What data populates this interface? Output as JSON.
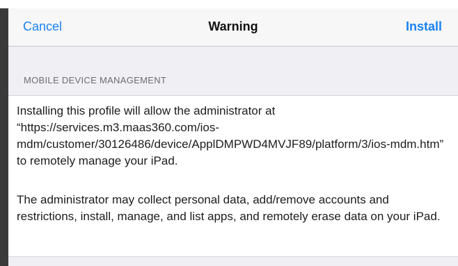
{
  "navbar": {
    "cancel_label": "Cancel",
    "title": "Warning",
    "install_label": "Install"
  },
  "section": {
    "header": "MOBILE DEVICE MANAGEMENT",
    "paragraph1": "Installing this profile will allow the administrator at “https://services.m3.maas360.com/ios-mdm/customer/30126486/device/ApplDMPWD4MVJF89/platform/3/ios-mdm.htm” to remotely manage your iPad.",
    "paragraph2": "The administrator may collect personal data, add/remove accounts and restrictions, install, manage, and list apps, and remotely erase data on your iPad."
  },
  "colors": {
    "accent": "#1a82f0",
    "nav_background": "#f7f7f7",
    "grouped_background": "#efeff4"
  }
}
